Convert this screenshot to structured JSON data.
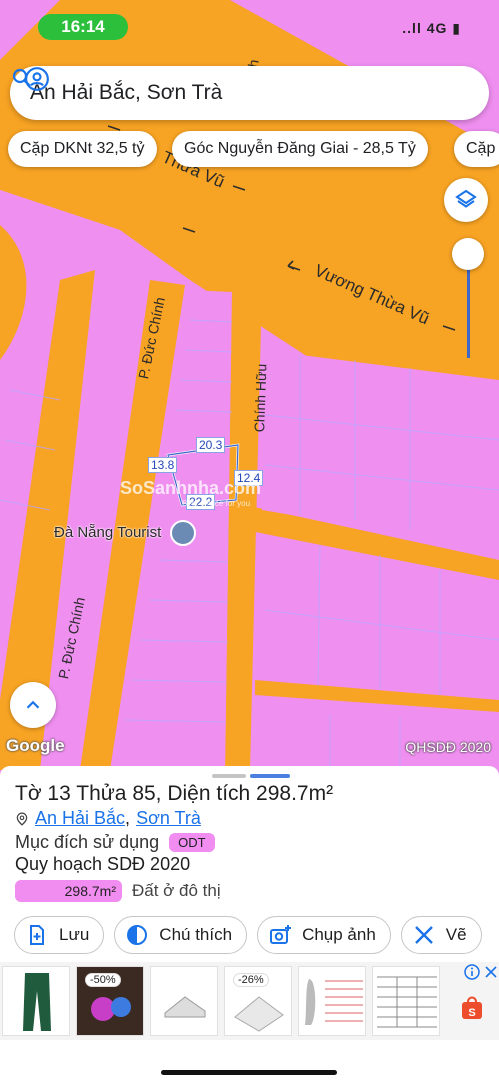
{
  "status_bar": {
    "time": "16:14",
    "icons_text": "..ll 4G ▮"
  },
  "search": {
    "query": "An Hải Bắc, Sơn Trà"
  },
  "chips": [
    {
      "label": "Cặp DKNt 32,5 tỷ"
    },
    {
      "label": "Góc Nguyễn Đăng Giai - 28,5 Tỷ"
    },
    {
      "label": "Cặp"
    }
  ],
  "map": {
    "streets": {
      "s1": "Vương Thừa Vũ",
      "s2": "Thừa Vũ",
      "s3": "P. Đức Chính",
      "s4": "P. Đức Chính",
      "s5": "Chính Hữu",
      "s6": "Chính",
      "s7": "ảnh"
    },
    "dimensions": {
      "top": "20.3",
      "left": "13.8",
      "right": "12.4",
      "bottom": "22.2"
    },
    "poi": "Đà Nẵng Tourist",
    "watermark": {
      "brand": "SoSanhnha.com",
      "tagline": "Best choice for you"
    },
    "attribution": "Google",
    "layer_label": "QHSDĐ 2020"
  },
  "sheet": {
    "title": "Tờ 13 Thửa 85, Diện tích 298.7m²",
    "ward": "An Hải Bắc",
    "separator": ",",
    "district": "Sơn Trà",
    "purpose_label": "Mục đích sử dụng",
    "purpose_code": "ODT",
    "plan_label": "Quy hoạch SDĐ 2020",
    "area_value": "298.7m²",
    "area_type": "Đất ở đô thị",
    "actions": {
      "save": "Lưu",
      "legend": "Chú thích",
      "photo": "Chụp ảnh",
      "draw": "Vẽ"
    }
  },
  "ads": {
    "tag1": "-50%",
    "tag2": "-26%"
  },
  "colors": {
    "residential": "#ef8ff0",
    "road": "#f7a323",
    "accent": "#1a73e8"
  }
}
